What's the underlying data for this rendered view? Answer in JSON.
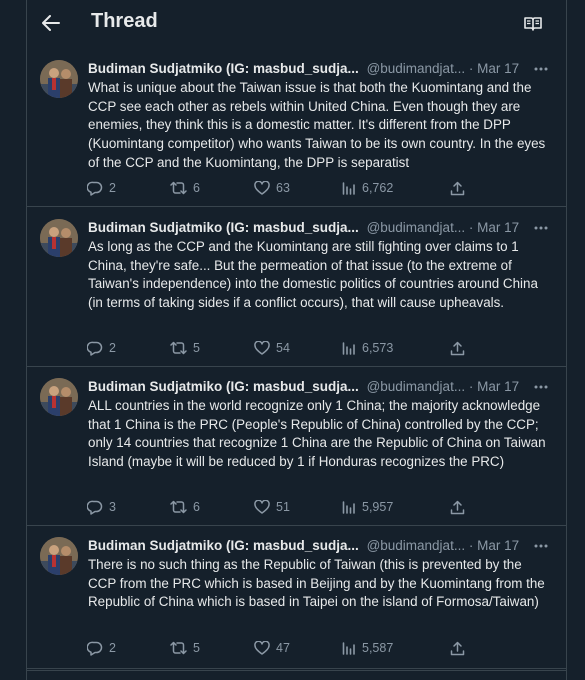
{
  "header": {
    "title": "Thread",
    "back_icon": "arrow-left-icon",
    "reader_icon": "book-open-icon"
  },
  "tweets": [
    {
      "author": "Budiman Sudjatmiko (IG: masbud_sudja...",
      "handle": "@budimandjat...",
      "dot": "·",
      "date": "Mar 17",
      "text": "What is unique about the Taiwan issue is that both the Kuomintang and the CCP see each other as rebels within United China. Even though they are enemies, they think this is a domestic matter. It's different from the DPP (Kuomintang competitor) who wants Taiwan to be its own country. In the eyes of the CCP and the Kuomintang, the DPP is separatist",
      "replies": "2",
      "retweets": "6",
      "likes": "63",
      "views": "6,762"
    },
    {
      "author": "Budiman Sudjatmiko (IG: masbud_sudja...",
      "handle": "@budimandjat...",
      "dot": "·",
      "date": "Mar 17",
      "text": "As long as the CCP and the Kuomintang are still fighting over claims to 1 China, they're safe... But the permeation of that issue (to the extreme of Taiwan's independence) into the domestic politics of countries around China (in terms of taking sides if a conflict occurs), that will cause upheavals.",
      "replies": "2",
      "retweets": "5",
      "likes": "54",
      "views": "6,573"
    },
    {
      "author": "Budiman Sudjatmiko (IG: masbud_sudja...",
      "handle": "@budimandjat...",
      "dot": "·",
      "date": "Mar 17",
      "text": "ALL countries in the world recognize only 1 China; the majority acknowledge that 1 China is the PRC (People's Republic of China) controlled by the CCP; only 14 countries that recognize 1 China are the Republic of China on Taiwan Island (maybe it will be reduced by 1 if Honduras recognizes the PRC)",
      "replies": "3",
      "retweets": "6",
      "likes": "51",
      "views": "5,957"
    },
    {
      "author": "Budiman Sudjatmiko (IG: masbud_sudja...",
      "handle": "@budimandjat...",
      "dot": "·",
      "date": "Mar 17",
      "text": "There is no such thing as the Republic of Taiwan (this is prevented by the CCP from the PRC which is based in Beijing and by the Kuomintang from the Republic of China which is based in Taipei on the island of Formosa/Taiwan)",
      "replies": "2",
      "retweets": "5",
      "likes": "47",
      "views": "5,587"
    }
  ],
  "icons": {
    "reply": "reply-icon",
    "retweet": "retweet-icon",
    "like": "heart-icon",
    "views": "views-icon",
    "share": "share-icon",
    "more": "more-icon"
  },
  "colors": {
    "background": "#15202b",
    "text": "#e7e9ea",
    "muted": "#8b98a5",
    "border": "#38444d"
  }
}
